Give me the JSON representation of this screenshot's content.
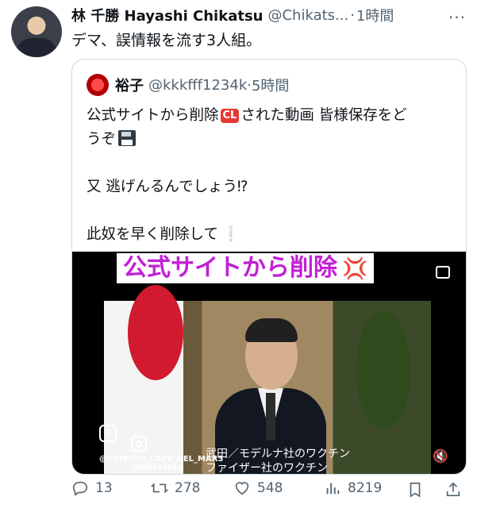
{
  "tweet": {
    "author_name": "林 千勝 Hayashi Chikatsu",
    "author_handle": "@Chikats...",
    "separator": "·",
    "time": "1時間",
    "text": "デマ、誤情報を流す3人組。"
  },
  "quote": {
    "author_name": "裕子",
    "author_handle": "@kkkfff1234k",
    "separator": "·",
    "time": "5時間",
    "line1_before": "公式サイトから削除",
    "cl_badge": "CL",
    "line1_after": "された動画 皆様保存をど",
    "line2": "うぞ",
    "line3": "又 逃げんるんでしょう⁉",
    "line4": "此奴を早く削除して",
    "excl": "❕"
  },
  "video": {
    "banner": "公式サイトから削除",
    "banner_emoji": "💢",
    "watermark1": "@TOMOYO_CAFE_DEL_MAR3",
    "watermark2": "@MA3588SA",
    "subtitle1": "武田／モデルナ社のワクチン",
    "subtitle2": "ファイザー社のワクチン",
    "mute_glyph": "🔇"
  },
  "actions": {
    "replies": "13",
    "retweets": "278",
    "likes": "548",
    "views": "8219"
  },
  "colors": {
    "muted": "#536471",
    "banner_text": "#c21fd6"
  },
  "icons": [
    "more-icon",
    "reply-icon",
    "retweet-icon",
    "like-icon",
    "views-icon",
    "bookmark-icon",
    "share-icon"
  ]
}
